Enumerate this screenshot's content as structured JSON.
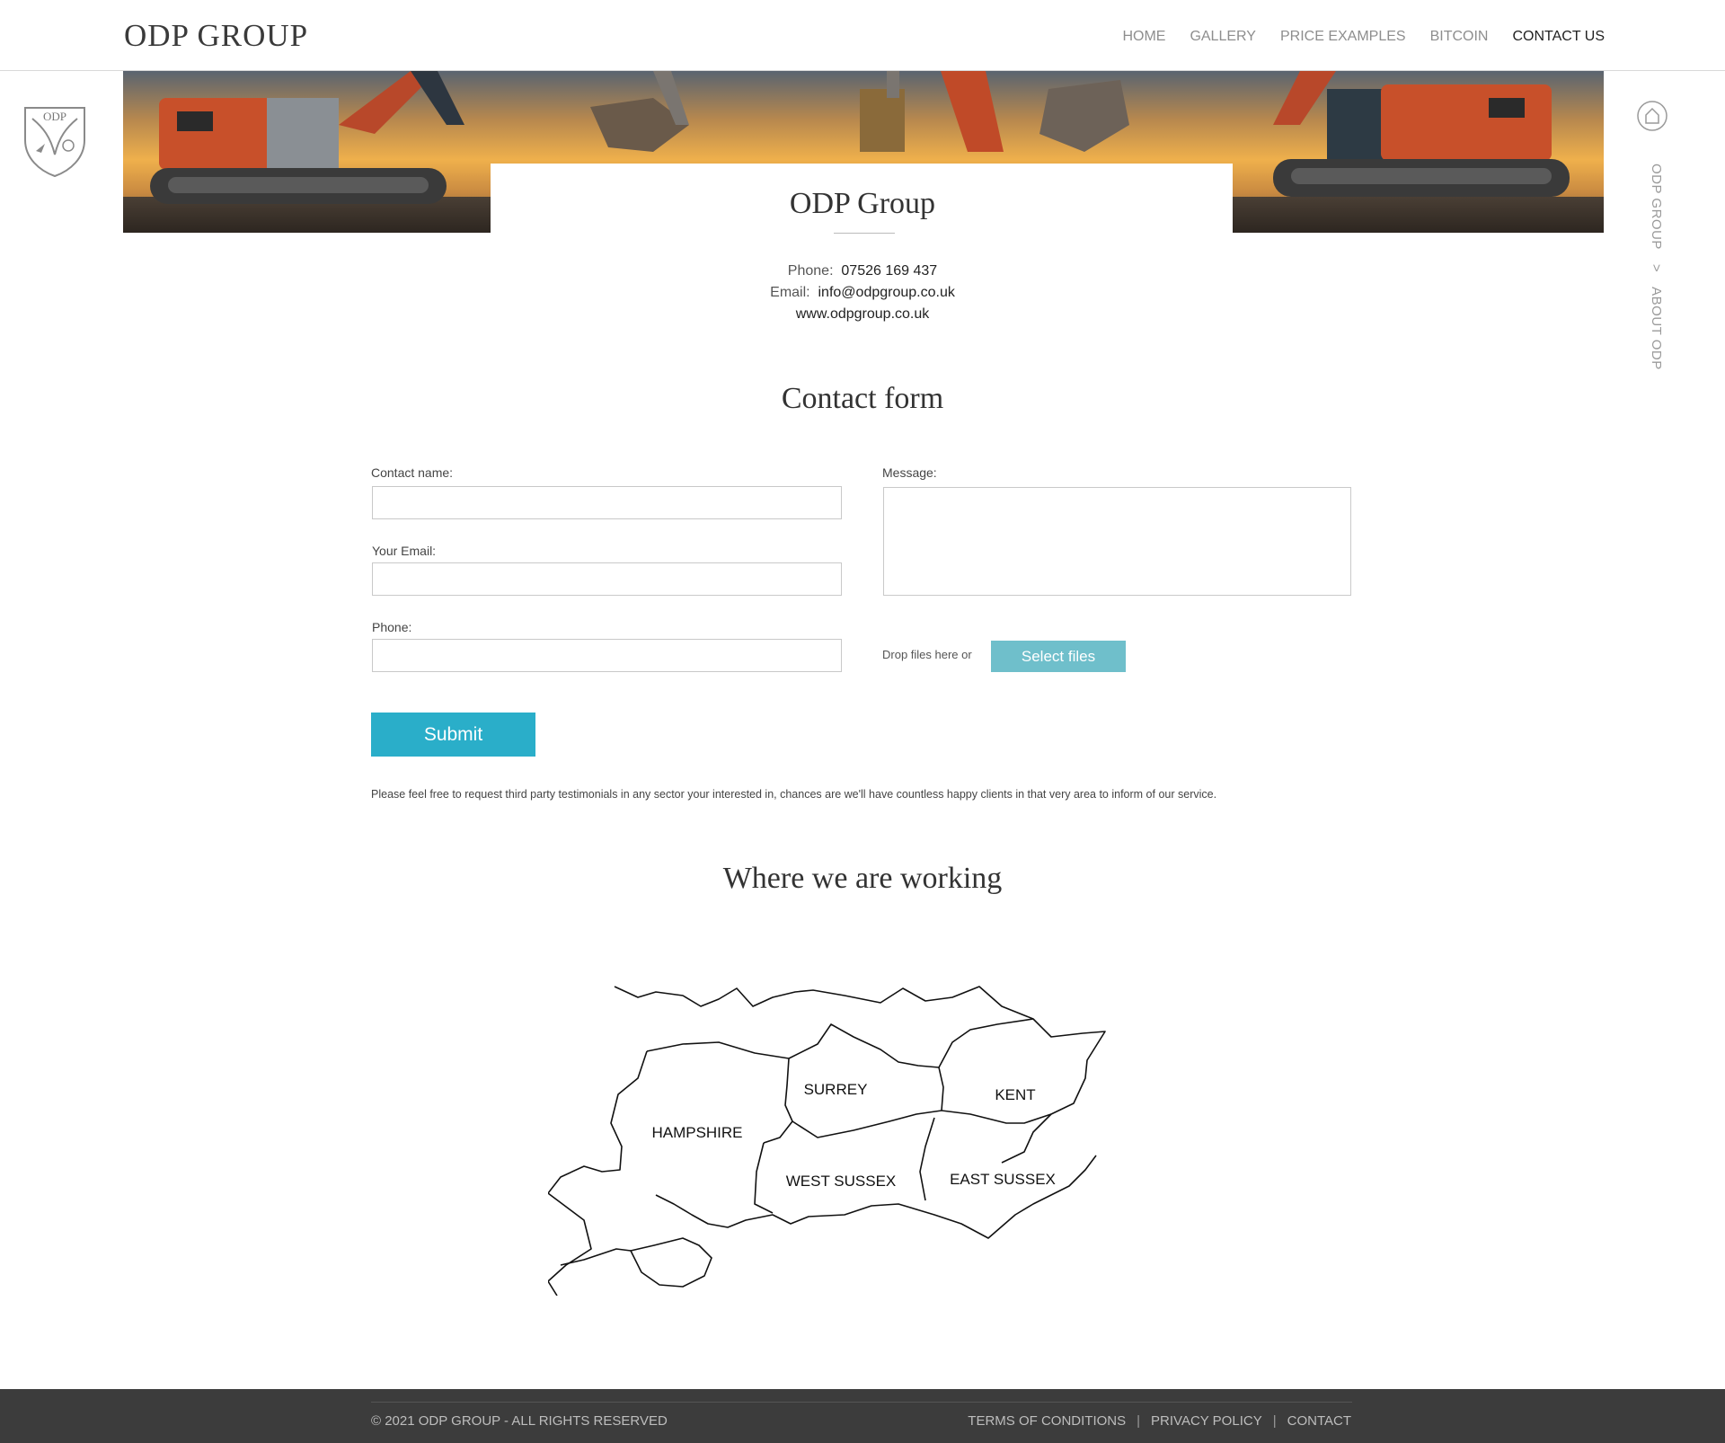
{
  "header": {
    "logo": "ODP GROUP",
    "nav": [
      "HOME",
      "GALLERY",
      "PRICE EXAMPLES",
      "BITCOIN",
      "CONTACT US"
    ],
    "active_index": 4
  },
  "crest": {
    "text": "ODP"
  },
  "rail": {
    "items": [
      "ODP GROUP",
      ">",
      "ABOUT ODP"
    ]
  },
  "company": {
    "name": "ODP Group",
    "phone_label": "Phone:",
    "phone": "07526 169 437",
    "email_label": "Email:",
    "email": "info@odpgroup.co.uk",
    "website": "www.odpgroup.co.uk"
  },
  "form": {
    "title": "Contact form",
    "name_label": "Contact name:",
    "email_label": "Your Email:",
    "phone_label": "Phone:",
    "message_label": "Message:",
    "drop_text": "Drop files here or",
    "select_files": "Select files",
    "submit": "Submit",
    "note": "Please feel free to request third party testimonials in any sector your interested in, chances are we'll have countless happy clients in that very area to inform of our service."
  },
  "map": {
    "title": "Where we are working",
    "regions": [
      "SURREY",
      "KENT",
      "HAMPSHIRE",
      "WEST SUSSEX",
      "EAST SUSSEX"
    ]
  },
  "footer": {
    "copyright": "© 2021 ODP GROUP - ALL RIGHTS RESERVED",
    "links": [
      "TERMS OF CONDITIONS",
      "PRIVACY POLICY",
      "CONTACT"
    ]
  },
  "colors": {
    "accent": "#2aaec9",
    "select_button": "#6fbfcb",
    "footer_bg": "#3c3c3c"
  }
}
